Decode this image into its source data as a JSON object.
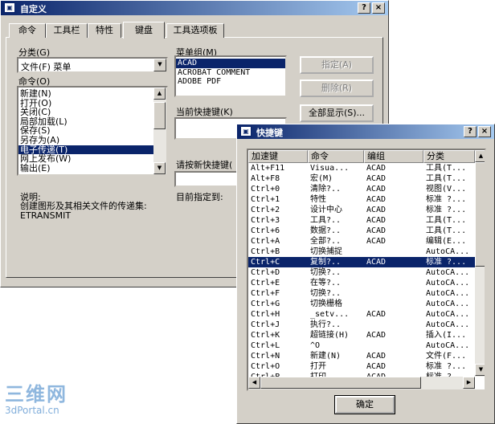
{
  "customize": {
    "title": "自定义",
    "help_btn": "?",
    "close_btn": "×",
    "tabs": [
      "命令",
      "工具栏",
      "特性",
      "键盘",
      "工具选项板"
    ],
    "category_label": "分类(G)",
    "category_value": "文件(F) 菜单",
    "commands_label": "命令(O)",
    "commands": [
      "新建(N)",
      "打开(O)",
      "关闭(C)",
      "局部加载(L)",
      "保存(S)",
      "另存为(A)",
      "电子传递(T)",
      "网上发布(W)",
      "输出(E)"
    ],
    "menu_group_label": "菜单组(M)",
    "menu_groups": [
      "ACAD",
      "ACROBAT COMMENT",
      "ADOBE PDF"
    ],
    "current_keys_label": "当前快捷键(K)",
    "press_new_label": "请按新快捷键(",
    "currently_assigned_label": "目前指定到:",
    "assign_btn": "指定(A)",
    "remove_btn": "删除(R)",
    "show_all_btn": "全部显示(S)...",
    "description_label": "说明:",
    "description_text": "创建图形及其相关文件的传递集: ETRANSMIT"
  },
  "shortcuts": {
    "title": "快捷键",
    "help_btn": "?",
    "close_btn": "×",
    "columns": [
      "加速键",
      "命令",
      "编组",
      "分类"
    ],
    "rows": [
      [
        "Alt+F11",
        "Visua...",
        "ACAD",
        "工具(T..."
      ],
      [
        "Alt+F8",
        "宏(M)",
        "ACAD",
        "工具(T..."
      ],
      [
        "Ctrl+0",
        "清除?..",
        "ACAD",
        "视图(V..."
      ],
      [
        "Ctrl+1",
        "特性",
        "ACAD",
        "标准 ?..."
      ],
      [
        "Ctrl+2",
        "设计中心",
        "ACAD",
        "标准 ?..."
      ],
      [
        "Ctrl+3",
        "工具?..",
        "ACAD",
        "工具(T..."
      ],
      [
        "Ctrl+6",
        "数据?..",
        "ACAD",
        "工具(T..."
      ],
      [
        "Ctrl+A",
        "全部?..",
        "ACAD",
        "编辑(E..."
      ],
      [
        "Ctrl+B",
        "切换捕捉",
        "",
        "AutoCA..."
      ],
      [
        "Ctrl+C",
        "复制?..",
        "ACAD",
        "标准 ?..."
      ],
      [
        "Ctrl+D",
        "切换?..",
        "",
        "AutoCA..."
      ],
      [
        "Ctrl+E",
        "在等?..",
        "",
        "AutoCA..."
      ],
      [
        "Ctrl+F",
        "切换?..",
        "",
        "AutoCA..."
      ],
      [
        "Ctrl+G",
        "切换栅格",
        "",
        "AutoCA..."
      ],
      [
        "Ctrl+H",
        "_setv...",
        "ACAD",
        "AutoCA..."
      ],
      [
        "Ctrl+J",
        "执行?..",
        "",
        "AutoCA..."
      ],
      [
        "Ctrl+K",
        "超链接(H)",
        "ACAD",
        "插入(I..."
      ],
      [
        "Ctrl+L",
        "^O",
        "",
        "AutoCA..."
      ],
      [
        "Ctrl+N",
        "新建(N)",
        "ACAD",
        "文件(F..."
      ],
      [
        "Ctrl+O",
        "打开",
        "ACAD",
        "标准 ?..."
      ],
      [
        "Ctrl+P",
        "打印",
        "ACAD",
        "标准 ?..."
      ]
    ],
    "selected_index": 9,
    "ok_btn": "确定"
  },
  "watermark": {
    "line1": "三维网",
    "line2": "3dPortal.cn"
  }
}
